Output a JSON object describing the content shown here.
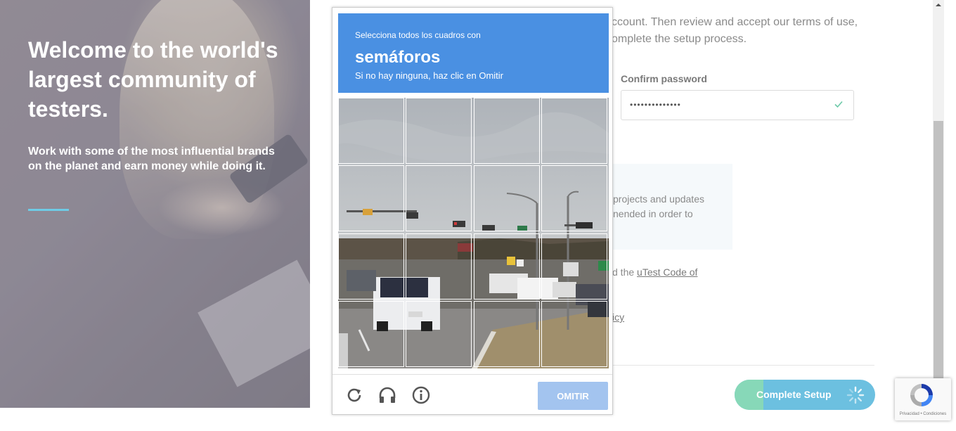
{
  "hero": {
    "title": "Welcome to the world's largest community of testers.",
    "subtitle": "Work with some of the most influential brands on the planet and earn money while doing it.",
    "accent_color": "#6ecbe6"
  },
  "form": {
    "intro_line1": "ccount. Then review and accept our terms of use,",
    "intro_line2": "omplete the setup process.",
    "confirm_password_label": "Confirm password",
    "confirm_password_value": "••••••••••••••",
    "info_line1": "projects and updates",
    "info_line2": "nended in order to",
    "code_prefix": "d the ",
    "code_link": "uTest Code of",
    "policy_link": "icy",
    "complete_button": "Complete Setup"
  },
  "captcha": {
    "instruction": "Selecciona todos los cuadros con",
    "object": "semáforos",
    "hint": "Si no hay ninguna, haz clic en Omitir",
    "skip_button": "OMITIR",
    "header_color": "#4a90e2",
    "footer_icons": [
      "reload-icon",
      "audio-icon",
      "info-icon"
    ]
  },
  "recaptcha_badge": {
    "text": "Privacidad • Condiciones"
  }
}
